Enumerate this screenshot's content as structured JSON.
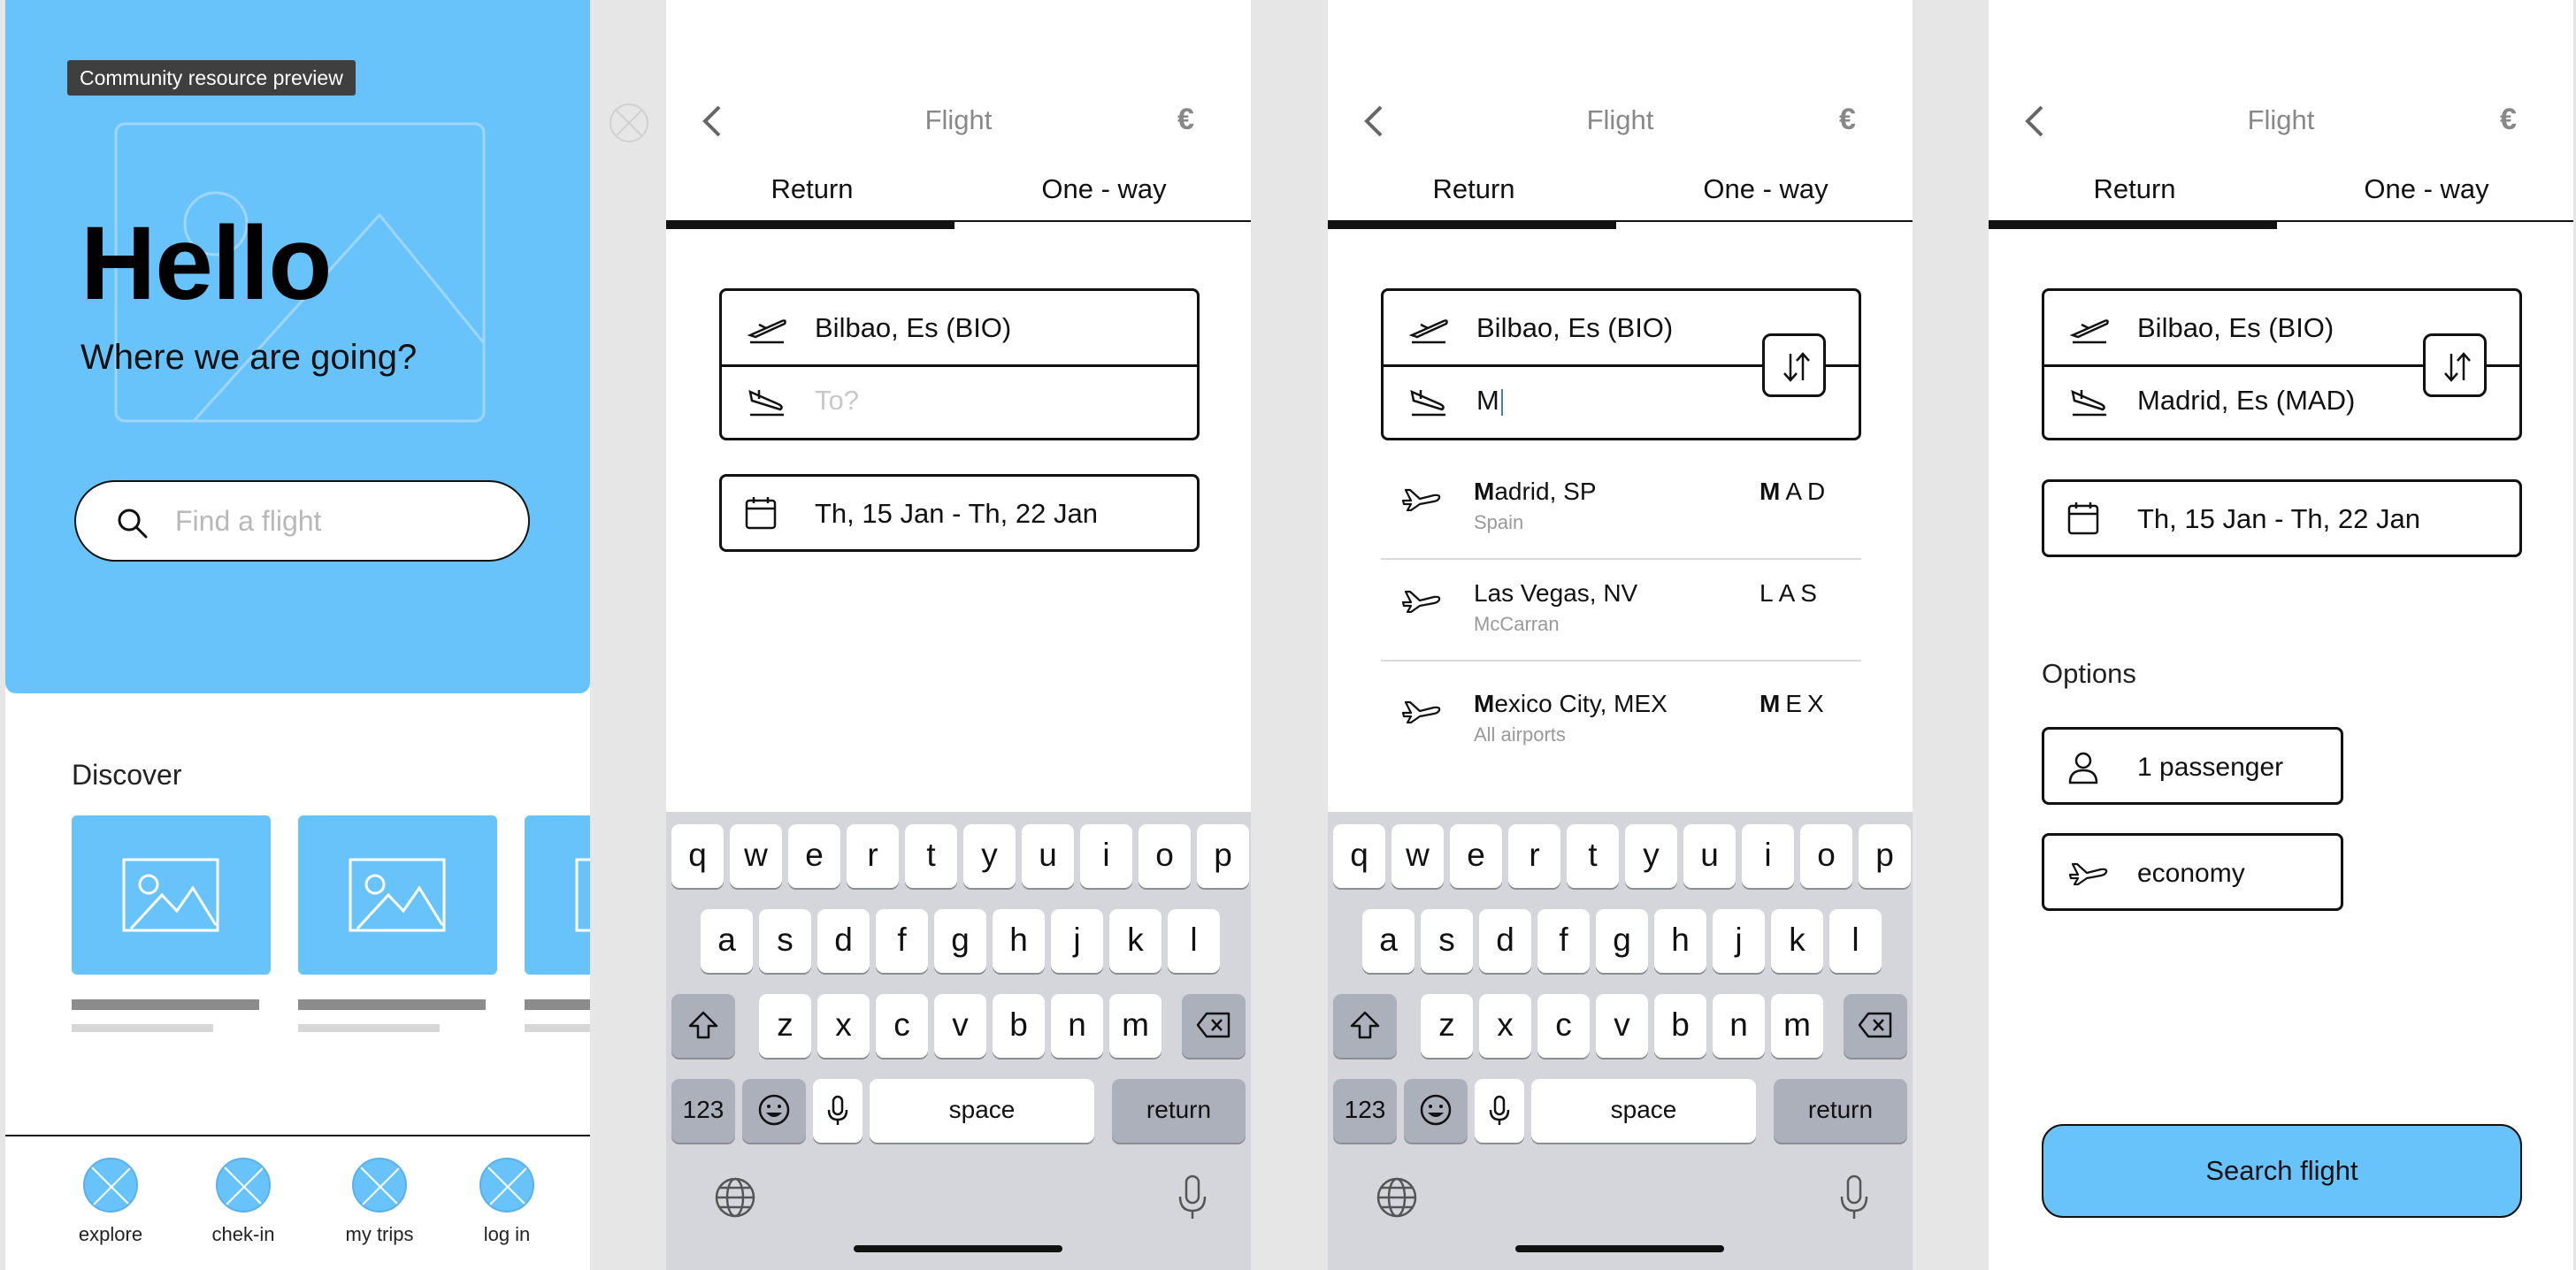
{
  "home": {
    "badge": "Community resource preview",
    "title": "Hello",
    "subtitle": "Where we are going?",
    "search_placeholder": "Find a flight",
    "discover_label": "Discover",
    "tabs": [
      {
        "label": "explore"
      },
      {
        "label": "chek-in"
      },
      {
        "label": "my trips"
      },
      {
        "label": "log in"
      }
    ],
    "colors": {
      "accent": "#69c3fb"
    }
  },
  "flight": {
    "title": "Flight",
    "currency": "€",
    "tab_return": "Return",
    "tab_oneway": "One - way",
    "from": "Bilbao, Es (BIO)",
    "to_placeholder": "To?",
    "to_typed": "M",
    "to_selected": "Madrid, Es (MAD)",
    "dates": "Th, 15 Jan - Th, 22 Jan"
  },
  "suggestions": [
    {
      "match": "M",
      "city_rest": "adrid, SP",
      "sub": "Spain",
      "code_match": "M",
      "code_rest": "AD"
    },
    {
      "match": "",
      "city_rest": "Las Vegas, NV",
      "sub": "McCarran",
      "code_match": "",
      "code_rest": "LAS"
    },
    {
      "match": "M",
      "city_rest": "exico City, MEX",
      "sub": "All airports",
      "code_match": "M",
      "code_rest": "EX"
    }
  ],
  "keyboard": {
    "row1": [
      "q",
      "w",
      "e",
      "r",
      "t",
      "y",
      "u",
      "i",
      "o",
      "p"
    ],
    "row2": [
      "a",
      "s",
      "d",
      "f",
      "g",
      "h",
      "j",
      "k",
      "l"
    ],
    "row3": [
      "z",
      "x",
      "c",
      "v",
      "b",
      "n",
      "m"
    ],
    "numbers": "123",
    "space": "space",
    "return": "return"
  },
  "options": {
    "label": "Options",
    "passengers": "1 passenger",
    "class": "economy",
    "search_button": "Search flight"
  }
}
